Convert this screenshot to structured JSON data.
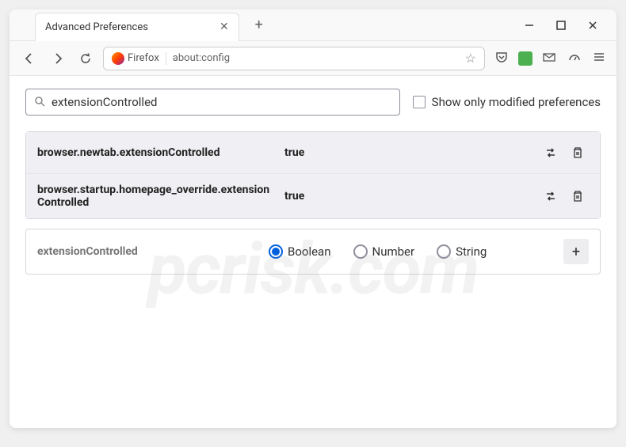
{
  "tab": {
    "title": "Advanced Preferences"
  },
  "urlbar": {
    "brand": "Firefox",
    "url": "about:config"
  },
  "search": {
    "value": "extensionControlled",
    "checkbox_label": "Show only modified preferences"
  },
  "prefs": [
    {
      "name": "browser.newtab.extensionControlled",
      "value": "true"
    },
    {
      "name": "browser.startup.homepage_override.extensionControlled",
      "value": "true"
    }
  ],
  "new_pref": {
    "name": "extensionControlled",
    "types": [
      "Boolean",
      "Number",
      "String"
    ],
    "selected": 0
  },
  "watermark": "pcrisk.com"
}
